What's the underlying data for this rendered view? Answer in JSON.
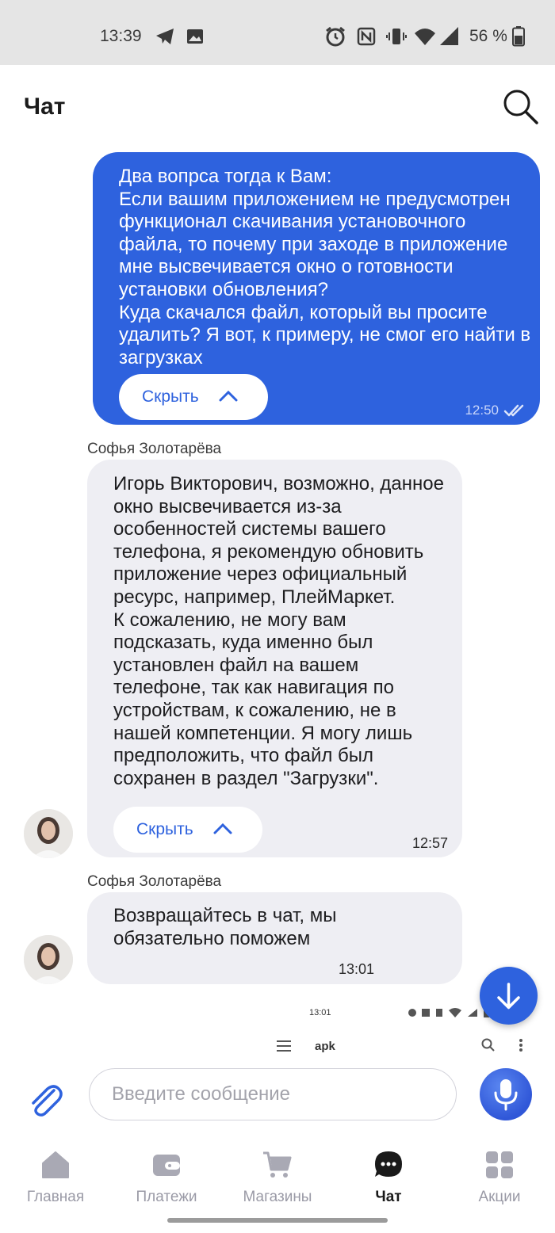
{
  "status_bar": {
    "time": "13:39",
    "battery": "56 %"
  },
  "header": {
    "title": "Чат"
  },
  "messages": {
    "outgoing": {
      "text": "Два вопрса тогда к Вам:\nЕсли вашим приложением не предусмотрен функционал скачивания установочного файла, то почему при заходе в приложение мне высвечивается окно о готовности установки обновления?\nКуда скачался файл, который вы просите удалить? Я вот, к примеру, не смог его найти в загрузках",
      "hide_label": "Скрыть",
      "time": "12:50"
    },
    "incoming_1": {
      "sender": "Софья Золотарёва",
      "text": "Игорь Викторович, возможно, данное окно высвечивается из-за особенностей системы вашего телефона, я рекомендую обновить приложение через официальный ресурс, например, ПлейМаркет.\nК сожалению, не могу вам подсказать, куда именно был установлен файл на вашем телефоне, так как навигация по устройствам, к сожалению, не в нашей компетенции. Я могу лишь предположить, что файл был сохранен в раздел \"Загрузки\".",
      "hide_label": "Скрыть",
      "time": "12:57"
    },
    "incoming_2": {
      "sender": "Софья Золотарёва",
      "text": "Возвращайтесь в чат, мы обязательно поможем",
      "time": "13:01"
    },
    "screenshot_preview": {
      "time": "13:01",
      "title": "apk"
    }
  },
  "composer": {
    "placeholder": "Введите сообщение"
  },
  "nav": {
    "home": "Главная",
    "payments": "Платежи",
    "stores": "Магазины",
    "chat": "Чат",
    "promos": "Акции"
  },
  "colors": {
    "accent": "#2e62de",
    "incoming_bubble": "#eeeef3",
    "status_bar": "#e5e5e5"
  }
}
